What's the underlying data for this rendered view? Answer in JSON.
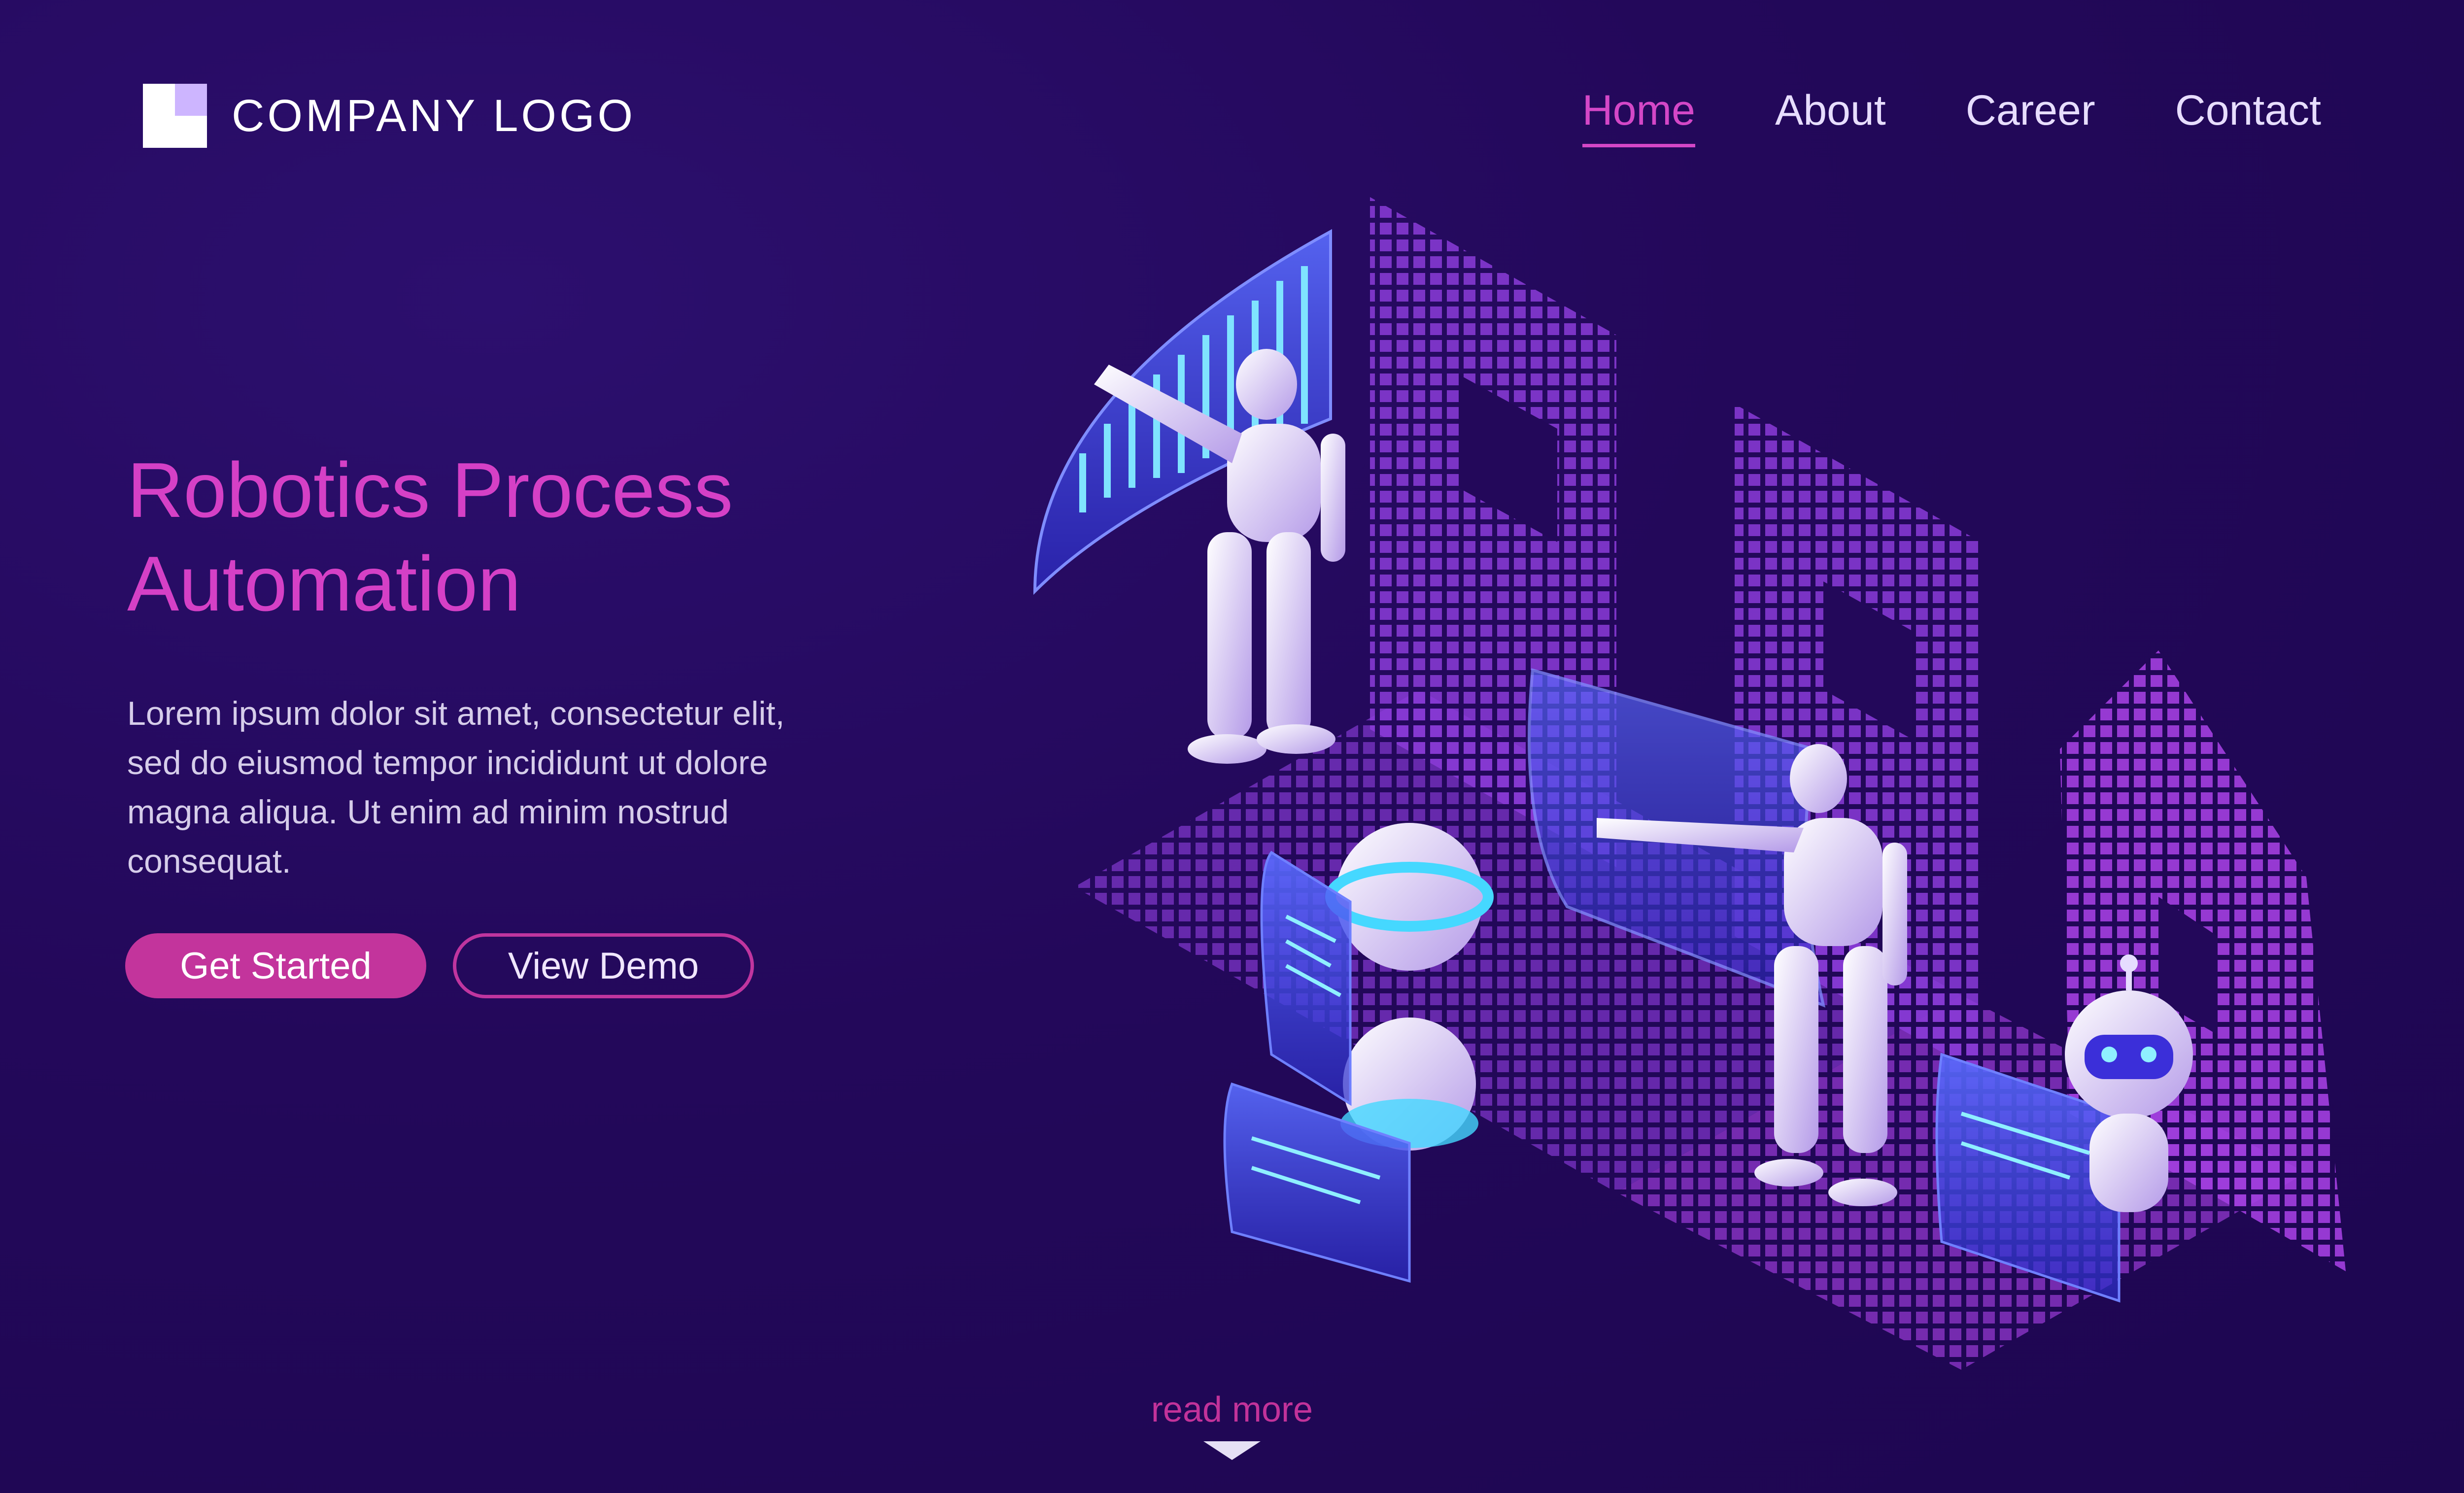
{
  "header": {
    "logo_text": "COMPANY LOGO",
    "nav": [
      "Home",
      "About",
      "Career",
      "Contact"
    ],
    "active_nav": "Home"
  },
  "hero": {
    "title_line1": "Robotics Process",
    "title_line2": "Automation",
    "description": "Lorem ipsum dolor sit amet, consectetur elit, sed do eiusmod tempor incididunt ut dolore magna aliqua. Ut enim ad minim nostrud consequat.",
    "primary_button": "Get Started",
    "secondary_button": "View Demo"
  },
  "footer": {
    "read_more": "read more"
  },
  "illustration": {
    "letters": [
      "R",
      "P",
      "A"
    ],
    "icons": [
      "rpa-illustration",
      "robot-icon",
      "chatbot-icon",
      "chart-screen-icon",
      "code-screen-icon"
    ]
  },
  "colors": {
    "background": "#23085a",
    "accent": "#d540c6",
    "button": "#c3349c",
    "text": "#e7ddff"
  }
}
